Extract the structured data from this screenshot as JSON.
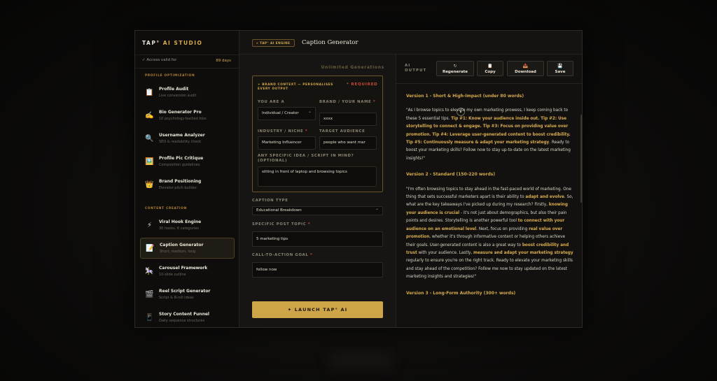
{
  "app": {
    "brand_prefix": "TAP°",
    "brand_suffix": "AI STUDIO",
    "access_label": "✓ Access valid for",
    "access_days": "89 days"
  },
  "sidebar": {
    "section_profile": "PROFILE OPTIMIZATION",
    "section_content": "CONTENT CREATION",
    "items": [
      {
        "icon": "📋",
        "title": "Profile Audit",
        "sub": "Live conversion audit"
      },
      {
        "icon": "✍️",
        "title": "Bio Generator Pro",
        "sub": "10 psychology-backed bios"
      },
      {
        "icon": "🔍",
        "title": "Username Analyzer",
        "sub": "SEO & readability check"
      },
      {
        "icon": "🖼️",
        "title": "Profile Pic Critique",
        "sub": "Composition guidelines"
      },
      {
        "icon": "👑",
        "title": "Brand Positioning",
        "sub": "Elevator pitch builder"
      },
      {
        "icon": "⚡",
        "title": "Viral Hook Engine",
        "sub": "30 hooks, 6 categories"
      },
      {
        "icon": "📝",
        "title": "Caption Generator",
        "sub": "Short, medium, long"
      },
      {
        "icon": "🎠",
        "title": "Carousel Framework",
        "sub": "10-slide outline"
      },
      {
        "icon": "🎬",
        "title": "Reel Script Generator",
        "sub": "Script & B-roll ideas"
      },
      {
        "icon": "📱",
        "title": "Story Content Funnel",
        "sub": "Daily sequence structures"
      }
    ]
  },
  "header": {
    "engine_pill": "» TAP° AI ENGINE",
    "title": "Caption Generator"
  },
  "form": {
    "unlimited": "Unlimited Generations",
    "brand_context_title": "✦ BRAND CONTEXT — PERSONALISES EVERY OUTPUT",
    "required": "* REQUIRED",
    "you_are_label": "YOU ARE A",
    "you_are_value": "Individual / Creator",
    "brand_name_label": "BRAND / YOUR NAME",
    "brand_name_value": "xxxx",
    "industry_label": "INDUSTRY / NICHE",
    "industry_value": "Marketing Influencer",
    "audience_label": "TARGET AUDIENCE",
    "audience_value": "people who want mar",
    "idea_label": "ANY SPECIFIC IDEA / SCRIPT IN MIND? (OPTIONAL)",
    "idea_value": "sitting in front of laptop and browsing topics",
    "caption_type_label": "CAPTION TYPE",
    "caption_type_value": "Educational Breakdown",
    "topic_label": "SPECIFIC POST TOPIC",
    "topic_value": "5 marketing tips",
    "cta_label": "CALL-TO-ACTION GOAL",
    "cta_value": "follow now",
    "launch_label": "✦ LAUNCH TAP° AI"
  },
  "output": {
    "label": "AI OUTPUT",
    "buttons": [
      {
        "icon": "↻",
        "label": "Regenerate"
      },
      {
        "icon": "📋",
        "label": "Copy"
      },
      {
        "icon": "📥",
        "label": "Download"
      },
      {
        "icon": "💾",
        "label": "Save"
      }
    ],
    "v1_heading": "Version 1 - Short & High-Impact (under 80 words)",
    "v1_parts": [
      {
        "t": "\"As I browse topics to elevate my own marketing prowess, I keep coming back to these 5 essential tips. ",
        "h": false
      },
      {
        "t": "Tip #1: Know your audience inside out. Tip #2: Use storytelling to connect & engage. Tip #3: Focus on providing value over promotion. Tip #4: Leverage user-generated content to boost credibility. Tip #5: Continuously measure & adapt your marketing strategy",
        "h": true
      },
      {
        "t": ". Ready to boost your marketing skills? Follow now to stay up-to-date on the latest marketing insights!\"",
        "h": false
      }
    ],
    "v2_heading": "Version 2 - Standard (150-220 words)",
    "v2_parts": [
      {
        "t": "\"I'm often browsing topics to stay ahead in the fast-paced world of marketing. One thing that sets successful marketers apart is their ability to ",
        "h": false
      },
      {
        "t": "adapt and evolve",
        "h": true
      },
      {
        "t": ". So, what are the key takeaways I've picked up during my research? Firstly, ",
        "h": false
      },
      {
        "t": "knowing your audience is crucial",
        "h": true
      },
      {
        "t": " - it's not just about demographics, but also their pain points and desires. Storytelling is another powerful tool ",
        "h": false
      },
      {
        "t": "to connect with your audience on an emotional level",
        "h": true
      },
      {
        "t": ". Next, focus on providing ",
        "h": false
      },
      {
        "t": "real value over promotion",
        "h": true
      },
      {
        "t": ", whether it's through informative content or helping others achieve their goals. User-generated content is also a great way to ",
        "h": false
      },
      {
        "t": "boost credibility and trust",
        "h": true
      },
      {
        "t": " with your audience. Lastly, ",
        "h": false
      },
      {
        "t": "measure and adapt your marketing strategy",
        "h": true
      },
      {
        "t": " regularly to ensure you're on the right track. Ready to elevate your marketing skills and stay ahead of the competition? Follow me now to stay updated on the latest marketing insights and strategies!\"",
        "h": false
      }
    ],
    "v3_heading": "Version 3 - Long-Form Authority (300+ words)"
  }
}
